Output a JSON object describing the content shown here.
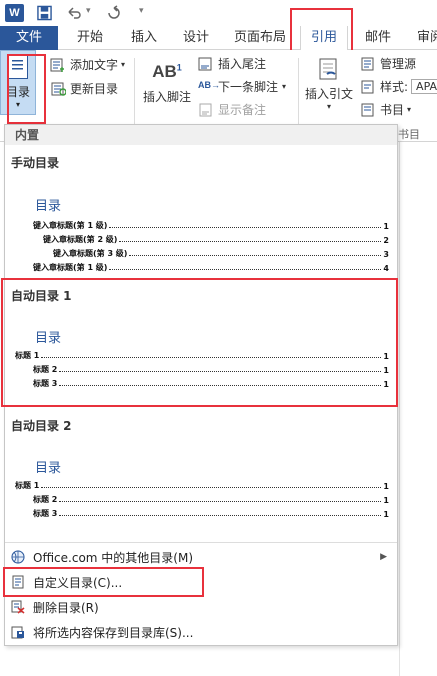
{
  "qat": {
    "app_letter": "W",
    "dropdown": "▾"
  },
  "tabs": [
    "文件",
    "开始",
    "插入",
    "设计",
    "页面布局",
    "引用",
    "邮件",
    "审阅"
  ],
  "ribbon": {
    "toc_label": "目录",
    "add_text": "添加文字",
    "update_toc": "更新目录",
    "insert_footnote_big": "AB",
    "insert_footnote_sup": "1",
    "insert_footnote": "插入脚注",
    "insert_endnote": "插入尾注",
    "next_footnote": "下一条脚注",
    "show_notes": "显示备注",
    "insert_citation": "插入引文",
    "manage_sources": "管理源",
    "style_label": "样式:",
    "style_value": "APA",
    "bibliography": "书目",
    "group_bib": "书目"
  },
  "menu": {
    "section_header": "内置",
    "gallery": [
      {
        "title": "手动目录",
        "heading": "目录",
        "lines": [
          {
            "text": "键入章标题(第 1 级)",
            "page": "1"
          },
          {
            "text": "键入章标题(第 2 级)",
            "page": "2"
          },
          {
            "text": "键入章标题(第 3 级)",
            "page": "3"
          },
          {
            "text": "键入章标题(第 1 级)",
            "page": "4"
          }
        ]
      },
      {
        "title": "自动目录 1",
        "heading": "目录",
        "lines": [
          {
            "text": "标题 1",
            "page": "1"
          },
          {
            "text": "标题 2",
            "page": "1"
          },
          {
            "text": "标题 3",
            "page": "1"
          }
        ]
      },
      {
        "title": "自动目录 2",
        "heading": "目录",
        "lines": [
          {
            "text": "标题 1",
            "page": "1"
          },
          {
            "text": "标题 2",
            "page": "1"
          },
          {
            "text": "标题 3",
            "page": "1"
          }
        ]
      }
    ],
    "items": [
      {
        "label": "Office.com 中的其他目录(M)",
        "icon": "office-icon"
      },
      {
        "label": "自定义目录(C)...",
        "icon": "doc-icon"
      },
      {
        "label": "删除目录(R)",
        "icon": "delete-toc-icon"
      },
      {
        "label": "将所选内容保存到目录库(S)...",
        "icon": "save-gallery-icon"
      }
    ]
  },
  "colors": {
    "accent": "#2b579a",
    "highlight": "#e8313c"
  }
}
